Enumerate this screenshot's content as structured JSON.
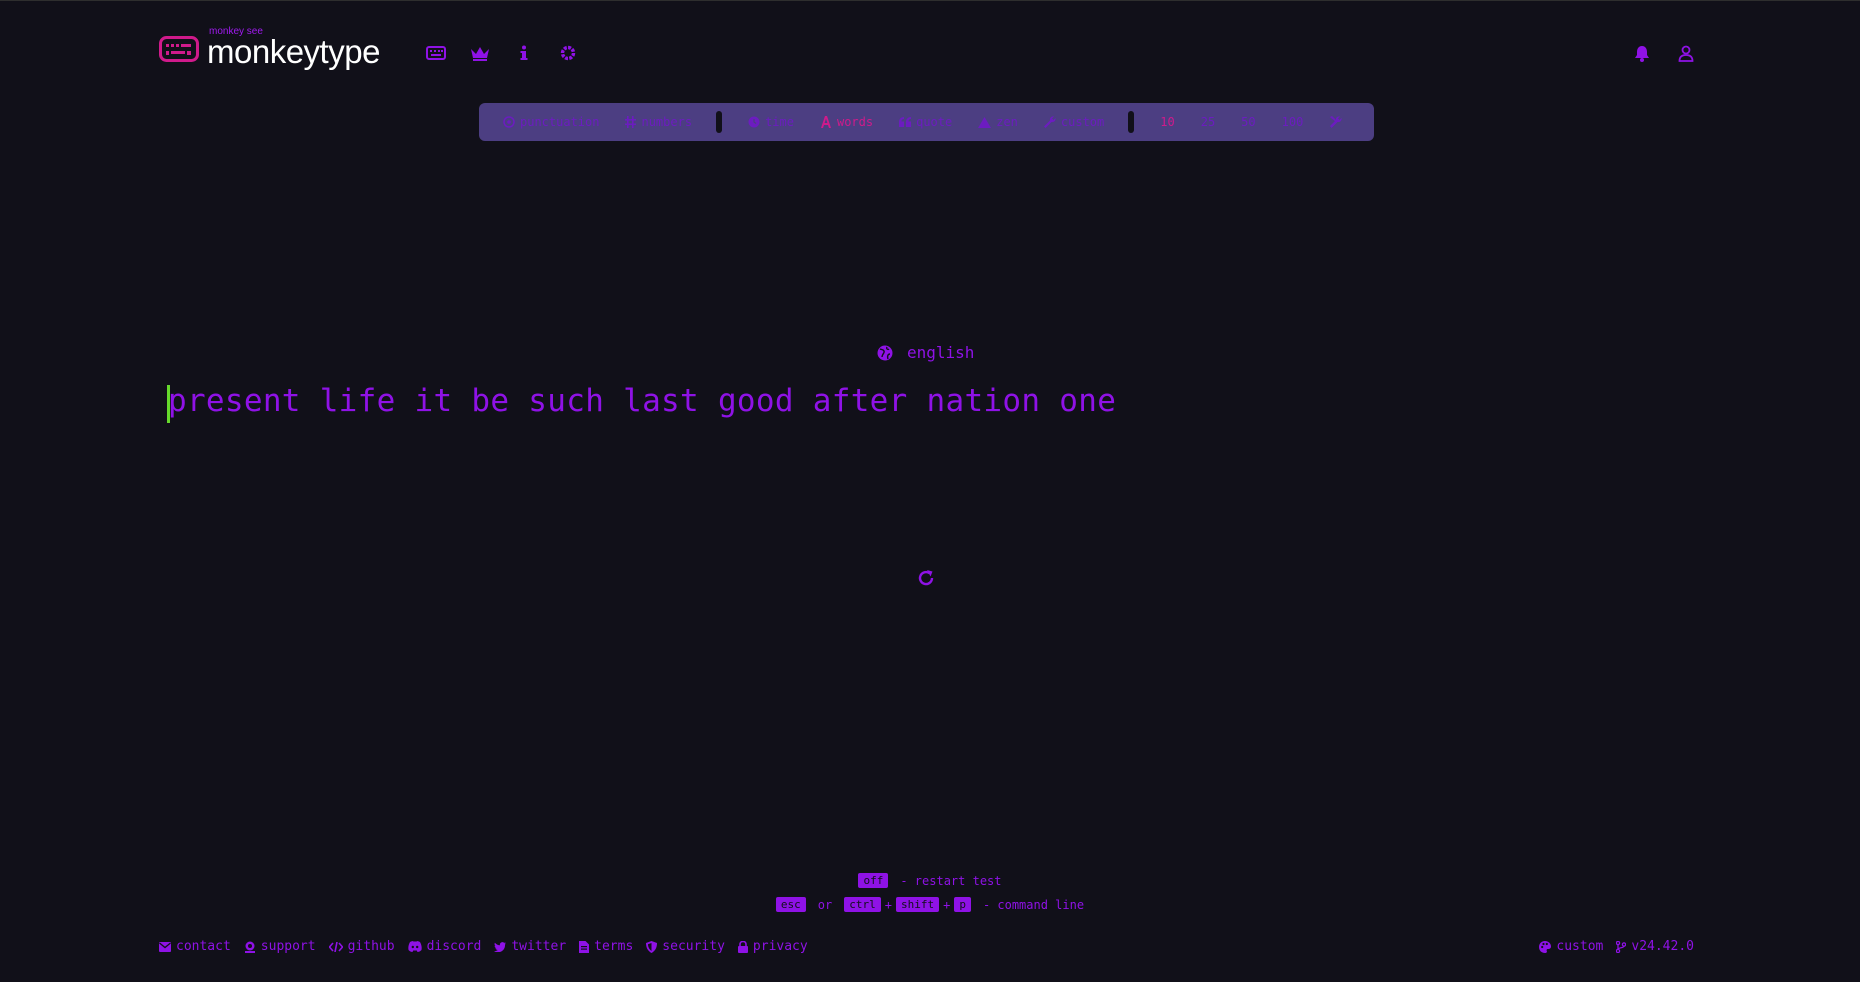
{
  "header": {
    "logo_subtitle": "monkey see",
    "logo_title": "monkeytype",
    "nav": [
      {
        "name": "keyboard-icon"
      },
      {
        "name": "crown-icon"
      },
      {
        "name": "info-icon"
      },
      {
        "name": "gear-icon"
      }
    ],
    "right": [
      {
        "name": "bell-icon"
      },
      {
        "name": "user-icon"
      }
    ]
  },
  "config_bar": {
    "punctuation": "punctuation",
    "numbers": "numbers",
    "time": "time",
    "words": "words",
    "quote": "quote",
    "zen": "zen",
    "custom": "custom",
    "counts": [
      "10",
      "25",
      "50",
      "100"
    ],
    "active_mode": "words",
    "active_count": "10"
  },
  "test": {
    "language": "english",
    "words": "present life it be such last good after nation one"
  },
  "hints": {
    "tab_key": "off",
    "restart_text": "- restart test",
    "esc_key": "esc",
    "or_text": "or",
    "ctrl_key": "ctrl",
    "plus": "+",
    "shift_key": "shift",
    "p_key": "p",
    "command_text": "- command line"
  },
  "footer": {
    "links": [
      "contact",
      "support",
      "github",
      "discord",
      "twitter",
      "terms",
      "security",
      "privacy"
    ],
    "theme": "custom",
    "version": "v24.42.0"
  },
  "colors": {
    "background": "#111019",
    "text": "#8f12e6",
    "accent": "#d01a8b",
    "caret": "#66d92c",
    "bar": "#4c3e82"
  }
}
